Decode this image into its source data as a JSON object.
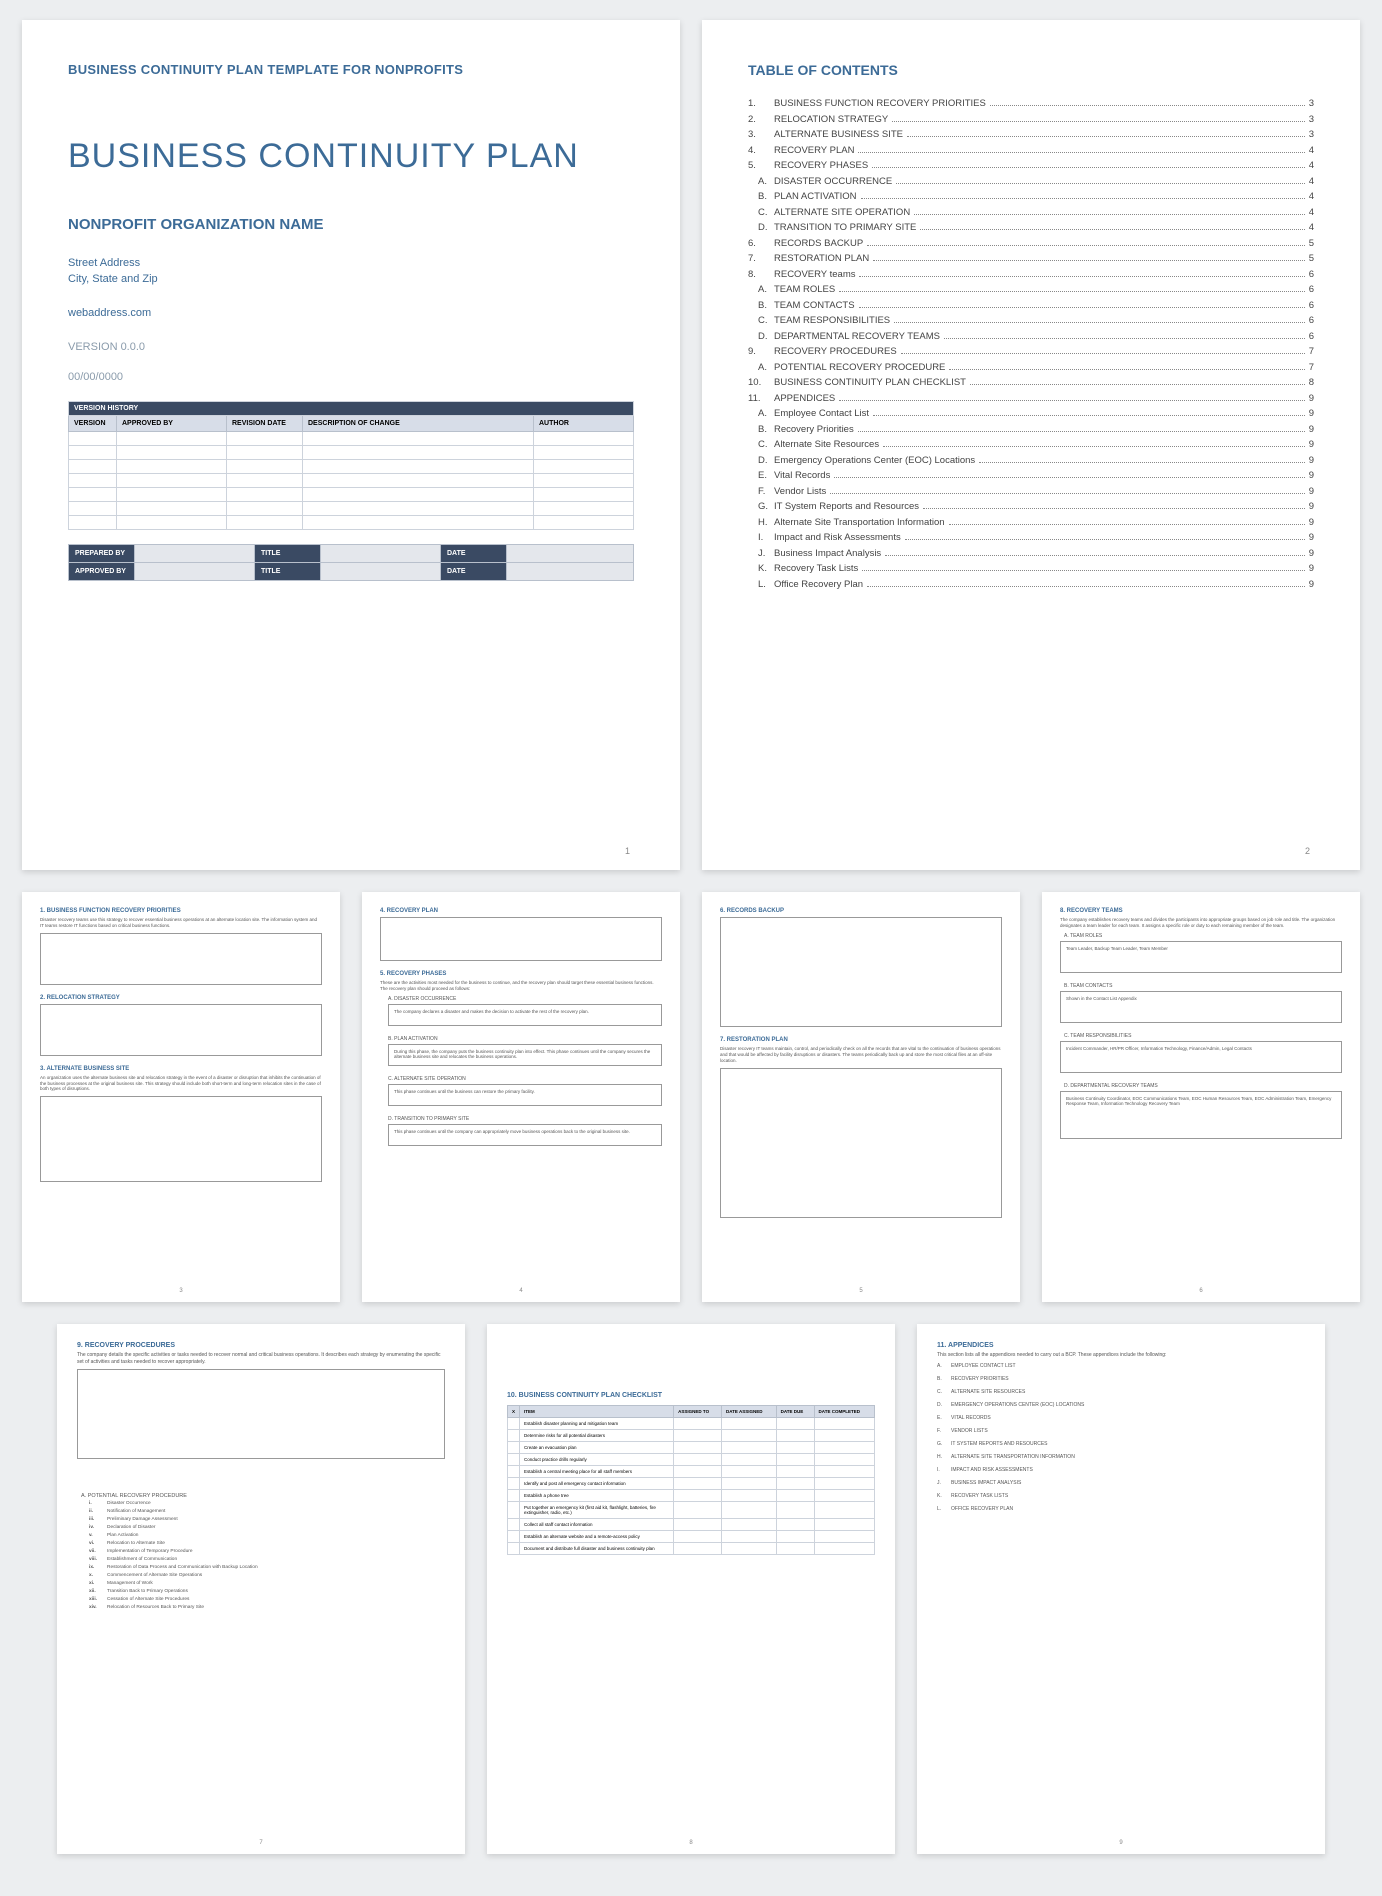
{
  "cover": {
    "pretitle": "BUSINESS CONTINUITY PLAN TEMPLATE FOR NONPROFITS",
    "title": "BUSINESS CONTINUITY PLAN",
    "org": "NONPROFIT ORGANIZATION NAME",
    "addr1": "Street Address",
    "addr2": "City, State and Zip",
    "web": "webaddress.com",
    "version": "VERSION 0.0.0",
    "date": "00/00/0000"
  },
  "vh": {
    "title": "VERSION HISTORY",
    "headers": [
      "VERSION",
      "APPROVED BY",
      "REVISION DATE",
      "DESCRIPTION OF CHANGE",
      "AUTHOR"
    ]
  },
  "sign": {
    "prepared": "PREPARED BY",
    "approved": "APPROVED BY",
    "title": "TITLE",
    "date": "DATE"
  },
  "toc": {
    "title": "TABLE OF CONTENTS",
    "items": [
      {
        "n": "1.",
        "t": "BUSINESS FUNCTION RECOVERY PRIORITIES",
        "p": "3"
      },
      {
        "n": "2.",
        "t": "RELOCATION STRATEGY",
        "p": "3"
      },
      {
        "n": "3.",
        "t": "ALTERNATE BUSINESS SITE",
        "p": "3"
      },
      {
        "n": "4.",
        "t": "RECOVERY PLAN",
        "p": "4"
      },
      {
        "n": "5.",
        "t": "RECOVERY PHASES",
        "p": "4"
      },
      {
        "n": "A.",
        "t": "DISASTER OCCURRENCE",
        "p": "4",
        "sub": true
      },
      {
        "n": "B.",
        "t": "PLAN ACTIVATION",
        "p": "4",
        "sub": true
      },
      {
        "n": "C.",
        "t": "ALTERNATE SITE OPERATION",
        "p": "4",
        "sub": true
      },
      {
        "n": "D.",
        "t": "TRANSITION TO PRIMARY SITE",
        "p": "4",
        "sub": true
      },
      {
        "n": "6.",
        "t": "RECORDS BACKUP",
        "p": "5"
      },
      {
        "n": "7.",
        "t": "RESTORATION PLAN",
        "p": "5"
      },
      {
        "n": "8.",
        "t": "RECOVERY teams",
        "p": "6"
      },
      {
        "n": "A.",
        "t": "TEAM ROLES",
        "p": "6",
        "sub": true
      },
      {
        "n": "B.",
        "t": "TEAM CONTACTS",
        "p": "6",
        "sub": true
      },
      {
        "n": "C.",
        "t": "TEAM RESPONSIBILITIES",
        "p": "6",
        "sub": true
      },
      {
        "n": "D.",
        "t": "DEPARTMENTAL RECOVERY TEAMS",
        "p": "6",
        "sub": true
      },
      {
        "n": "9.",
        "t": "RECOVERY PROCEDURES",
        "p": "7"
      },
      {
        "n": "A.",
        "t": "POTENTIAL RECOVERY PROCEDURE",
        "p": "7",
        "sub": true
      },
      {
        "n": "10.",
        "t": "BUSINESS CONTINUITY PLAN CHECKLIST",
        "p": "8"
      },
      {
        "n": "11.",
        "t": "APPENDICES",
        "p": "9"
      },
      {
        "n": "A.",
        "t": "Employee Contact List",
        "p": "9",
        "sub": true
      },
      {
        "n": "B.",
        "t": "Recovery Priorities",
        "p": "9",
        "sub": true
      },
      {
        "n": "C.",
        "t": "Alternate Site Resources",
        "p": "9",
        "sub": true
      },
      {
        "n": "D.",
        "t": "Emergency Operations Center (EOC) Locations",
        "p": "9",
        "sub": true
      },
      {
        "n": "E.",
        "t": "Vital Records",
        "p": "9",
        "sub": true
      },
      {
        "n": "F.",
        "t": "Vendor Lists",
        "p": "9",
        "sub": true
      },
      {
        "n": "G.",
        "t": "IT System Reports and Resources",
        "p": "9",
        "sub": true
      },
      {
        "n": "H.",
        "t": "Alternate Site Transportation Information",
        "p": "9",
        "sub": true
      },
      {
        "n": "I.",
        "t": "Impact and Risk Assessments",
        "p": "9",
        "sub": true
      },
      {
        "n": "J.",
        "t": "Business Impact Analysis",
        "p": "9",
        "sub": true
      },
      {
        "n": "K.",
        "t": "Recovery Task Lists",
        "p": "9",
        "sub": true
      },
      {
        "n": "L.",
        "t": "Office Recovery Plan",
        "p": "9",
        "sub": true
      }
    ]
  },
  "p3": {
    "h1": "1. BUSINESS FUNCTION RECOVERY PRIORITIES",
    "d1": "Disaster recovery teams use this strategy to recover essential business operations at an alternate location site. The information system and IT teams restore IT functions based on critical business functions.",
    "h2": "2. RELOCATION STRATEGY",
    "h3": "3. ALTERNATE BUSINESS SITE",
    "d3": "An organization uses the alternate business site and relocation strategy in the event of a disaster or disruption that inhibits the continuation of the business processes at the original business site. This strategy should include both short-term and long-term relocation sites in the case of both types of disruptions."
  },
  "p4": {
    "h1": "4. RECOVERY PLAN",
    "h2": "5. RECOVERY PHASES",
    "d2": "These are the activities most needed for the business to continue, and the recovery plan should target these essential business functions. The recovery plan should proceed as follows:",
    "sa": "A. DISASTER OCCURRENCE",
    "ta": "The company declares a disaster and makes the decision to activate the rest of the recovery plan.",
    "sb": "B. PLAN ACTIVATION",
    "tb": "During this phase, the company puts the business continuity plan into effect. This phase continues until the company secures the alternate business site and relocates the business operations.",
    "sc": "C. ALTERNATE SITE OPERATION",
    "tc": "This phase continues until the business can restore the primary facility.",
    "sd": "D. TRANSITION TO PRIMARY SITE",
    "td": "This phase continues until the company can appropriately move business operations back to the original business site."
  },
  "p5": {
    "h1": "6. RECORDS BACKUP",
    "h2": "7. RESTORATION PLAN",
    "d2": "Disaster recovery IT teams maintain, control, and periodically check on all the records that are vital to the continuation of business operations and that would be affected by facility disruptions or disasters. The teams periodically back up and store the most critical files at an off-site location."
  },
  "p6": {
    "h1": "8. RECOVERY TEAMS",
    "d1": "The company establishes recovery teams and divides the participants into appropriate groups based on job role and title. The organization designates a team leader for each team. It assigns a specific role or duty to each remaining member of the team.",
    "sa": "A. TEAM ROLES",
    "ta": "Team Leader, Backup Team Leader, Team Member",
    "sb": "B. TEAM CONTACTS",
    "tb": "Shown in the Contact List Appendix",
    "sc": "C. TEAM RESPONSIBILITIES",
    "tc": "Incident Commander, HR/PR Officer, Information Technology, Finance/Admin, Legal Contacts",
    "sd": "D. DEPARTMENTAL RECOVERY TEAMS",
    "td": "Business Continuity Coordinator, EOC Communications Team, EOC Human Resources Team, EOC Administration Team, Emergency Response Team, Information Technology Recovery Team"
  },
  "p7": {
    "h1": "9. RECOVERY PROCEDURES",
    "d1": "The company details the specific activities or tasks needed to recover normal and critical business operations. It describes each strategy by enumerating the specific set of activities and tasks needed to recover appropriately.",
    "sa": "A. POTENTIAL RECOVERY PROCEDURE",
    "steps": [
      {
        "r": "i.",
        "t": "Disaster Occurrence"
      },
      {
        "r": "ii.",
        "t": "Notification of Management"
      },
      {
        "r": "iii.",
        "t": "Preliminary Damage Assessment"
      },
      {
        "r": "iv.",
        "t": "Declaration of Disaster"
      },
      {
        "r": "v.",
        "t": "Plan Activation"
      },
      {
        "r": "vi.",
        "t": "Relocation to Alternate Site"
      },
      {
        "r": "vii.",
        "t": "Implementation of Temporary Procedure"
      },
      {
        "r": "viii.",
        "t": "Establishment of Communication"
      },
      {
        "r": "ix.",
        "t": "Restoration of Data Process and Communication with Backup Location"
      },
      {
        "r": "x.",
        "t": "Commencement of Alternate Site Operations"
      },
      {
        "r": "xi.",
        "t": "Management of Work"
      },
      {
        "r": "xii.",
        "t": "Transition Back to Primary Operations"
      },
      {
        "r": "xiii.",
        "t": "Cessation of Alternate Site Procedures"
      },
      {
        "r": "xiv.",
        "t": "Relocation of Resources Back to Primary Site"
      }
    ]
  },
  "p8": {
    "h1": "10. BUSINESS CONTINUITY PLAN CHECKLIST",
    "headers": [
      "X",
      "ITEM",
      "ASSIGNED TO",
      "DATE ASSIGNED",
      "DATE DUE",
      "DATE COMPLETED"
    ],
    "rows": [
      "Establish disaster planning and mitigation team",
      "Determine risks for all potential disasters",
      "Create an evacuation plan",
      "Conduct practice drills regularly",
      "Establish a central meeting place for all staff members",
      "Identify and post all emergency contact information",
      "Establish a phone tree",
      "Put together an emergency kit (first aid kit, flashlight, batteries, fire extinguisher, radio, etc.)",
      "Collect all staff contact information",
      "Establish an alternate website and a remote-access policy",
      "Document and distribute full disaster and business continuity plan"
    ]
  },
  "p9": {
    "h1": "11. APPENDICES",
    "d1": "This section lists all the appendices needed to carry out a BCP. These appendices include the following:",
    "items": [
      {
        "l": "A.",
        "t": "EMPLOYEE CONTACT LIST"
      },
      {
        "l": "B.",
        "t": "RECOVERY PRIORITIES"
      },
      {
        "l": "C.",
        "t": "ALTERNATE SITE RESOURCES"
      },
      {
        "l": "D.",
        "t": "EMERGENCY OPERATIONS CENTER (EOC) LOCATIONS"
      },
      {
        "l": "E.",
        "t": "VITAL RECORDS"
      },
      {
        "l": "F.",
        "t": "VENDOR LISTS"
      },
      {
        "l": "G.",
        "t": "IT SYSTEM REPORTS AND RESOURCES"
      },
      {
        "l": "H.",
        "t": "ALTERNATE SITE TRANSPORTATION INFORMATION"
      },
      {
        "l": "I.",
        "t": "IMPACT AND RISK ASSESSMENTS"
      },
      {
        "l": "J.",
        "t": "BUSINESS IMPACT ANALYSIS"
      },
      {
        "l": "K.",
        "t": "RECOVERY TASK LISTS"
      },
      {
        "l": "L.",
        "t": "OFFICE RECOVERY PLAN"
      }
    ]
  },
  "pagenums": {
    "p1": "1",
    "p2": "2",
    "p3": "3",
    "p4": "4",
    "p5": "5",
    "p6": "6",
    "p7": "7",
    "p8": "8",
    "p9": "9"
  }
}
